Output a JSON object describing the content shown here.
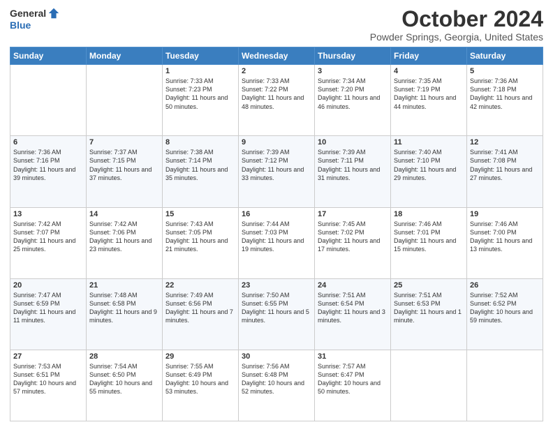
{
  "logo": {
    "general": "General",
    "blue": "Blue"
  },
  "header": {
    "month": "October 2024",
    "location": "Powder Springs, Georgia, United States"
  },
  "days_of_week": [
    "Sunday",
    "Monday",
    "Tuesday",
    "Wednesday",
    "Thursday",
    "Friday",
    "Saturday"
  ],
  "weeks": [
    [
      {
        "num": "",
        "info": ""
      },
      {
        "num": "",
        "info": ""
      },
      {
        "num": "1",
        "info": "Sunrise: 7:33 AM\nSunset: 7:23 PM\nDaylight: 11 hours and 50 minutes."
      },
      {
        "num": "2",
        "info": "Sunrise: 7:33 AM\nSunset: 7:22 PM\nDaylight: 11 hours and 48 minutes."
      },
      {
        "num": "3",
        "info": "Sunrise: 7:34 AM\nSunset: 7:20 PM\nDaylight: 11 hours and 46 minutes."
      },
      {
        "num": "4",
        "info": "Sunrise: 7:35 AM\nSunset: 7:19 PM\nDaylight: 11 hours and 44 minutes."
      },
      {
        "num": "5",
        "info": "Sunrise: 7:36 AM\nSunset: 7:18 PM\nDaylight: 11 hours and 42 minutes."
      }
    ],
    [
      {
        "num": "6",
        "info": "Sunrise: 7:36 AM\nSunset: 7:16 PM\nDaylight: 11 hours and 39 minutes."
      },
      {
        "num": "7",
        "info": "Sunrise: 7:37 AM\nSunset: 7:15 PM\nDaylight: 11 hours and 37 minutes."
      },
      {
        "num": "8",
        "info": "Sunrise: 7:38 AM\nSunset: 7:14 PM\nDaylight: 11 hours and 35 minutes."
      },
      {
        "num": "9",
        "info": "Sunrise: 7:39 AM\nSunset: 7:12 PM\nDaylight: 11 hours and 33 minutes."
      },
      {
        "num": "10",
        "info": "Sunrise: 7:39 AM\nSunset: 7:11 PM\nDaylight: 11 hours and 31 minutes."
      },
      {
        "num": "11",
        "info": "Sunrise: 7:40 AM\nSunset: 7:10 PM\nDaylight: 11 hours and 29 minutes."
      },
      {
        "num": "12",
        "info": "Sunrise: 7:41 AM\nSunset: 7:08 PM\nDaylight: 11 hours and 27 minutes."
      }
    ],
    [
      {
        "num": "13",
        "info": "Sunrise: 7:42 AM\nSunset: 7:07 PM\nDaylight: 11 hours and 25 minutes."
      },
      {
        "num": "14",
        "info": "Sunrise: 7:42 AM\nSunset: 7:06 PM\nDaylight: 11 hours and 23 minutes."
      },
      {
        "num": "15",
        "info": "Sunrise: 7:43 AM\nSunset: 7:05 PM\nDaylight: 11 hours and 21 minutes."
      },
      {
        "num": "16",
        "info": "Sunrise: 7:44 AM\nSunset: 7:03 PM\nDaylight: 11 hours and 19 minutes."
      },
      {
        "num": "17",
        "info": "Sunrise: 7:45 AM\nSunset: 7:02 PM\nDaylight: 11 hours and 17 minutes."
      },
      {
        "num": "18",
        "info": "Sunrise: 7:46 AM\nSunset: 7:01 PM\nDaylight: 11 hours and 15 minutes."
      },
      {
        "num": "19",
        "info": "Sunrise: 7:46 AM\nSunset: 7:00 PM\nDaylight: 11 hours and 13 minutes."
      }
    ],
    [
      {
        "num": "20",
        "info": "Sunrise: 7:47 AM\nSunset: 6:59 PM\nDaylight: 11 hours and 11 minutes."
      },
      {
        "num": "21",
        "info": "Sunrise: 7:48 AM\nSunset: 6:58 PM\nDaylight: 11 hours and 9 minutes."
      },
      {
        "num": "22",
        "info": "Sunrise: 7:49 AM\nSunset: 6:56 PM\nDaylight: 11 hours and 7 minutes."
      },
      {
        "num": "23",
        "info": "Sunrise: 7:50 AM\nSunset: 6:55 PM\nDaylight: 11 hours and 5 minutes."
      },
      {
        "num": "24",
        "info": "Sunrise: 7:51 AM\nSunset: 6:54 PM\nDaylight: 11 hours and 3 minutes."
      },
      {
        "num": "25",
        "info": "Sunrise: 7:51 AM\nSunset: 6:53 PM\nDaylight: 11 hours and 1 minute."
      },
      {
        "num": "26",
        "info": "Sunrise: 7:52 AM\nSunset: 6:52 PM\nDaylight: 10 hours and 59 minutes."
      }
    ],
    [
      {
        "num": "27",
        "info": "Sunrise: 7:53 AM\nSunset: 6:51 PM\nDaylight: 10 hours and 57 minutes."
      },
      {
        "num": "28",
        "info": "Sunrise: 7:54 AM\nSunset: 6:50 PM\nDaylight: 10 hours and 55 minutes."
      },
      {
        "num": "29",
        "info": "Sunrise: 7:55 AM\nSunset: 6:49 PM\nDaylight: 10 hours and 53 minutes."
      },
      {
        "num": "30",
        "info": "Sunrise: 7:56 AM\nSunset: 6:48 PM\nDaylight: 10 hours and 52 minutes."
      },
      {
        "num": "31",
        "info": "Sunrise: 7:57 AM\nSunset: 6:47 PM\nDaylight: 10 hours and 50 minutes."
      },
      {
        "num": "",
        "info": ""
      },
      {
        "num": "",
        "info": ""
      }
    ]
  ]
}
